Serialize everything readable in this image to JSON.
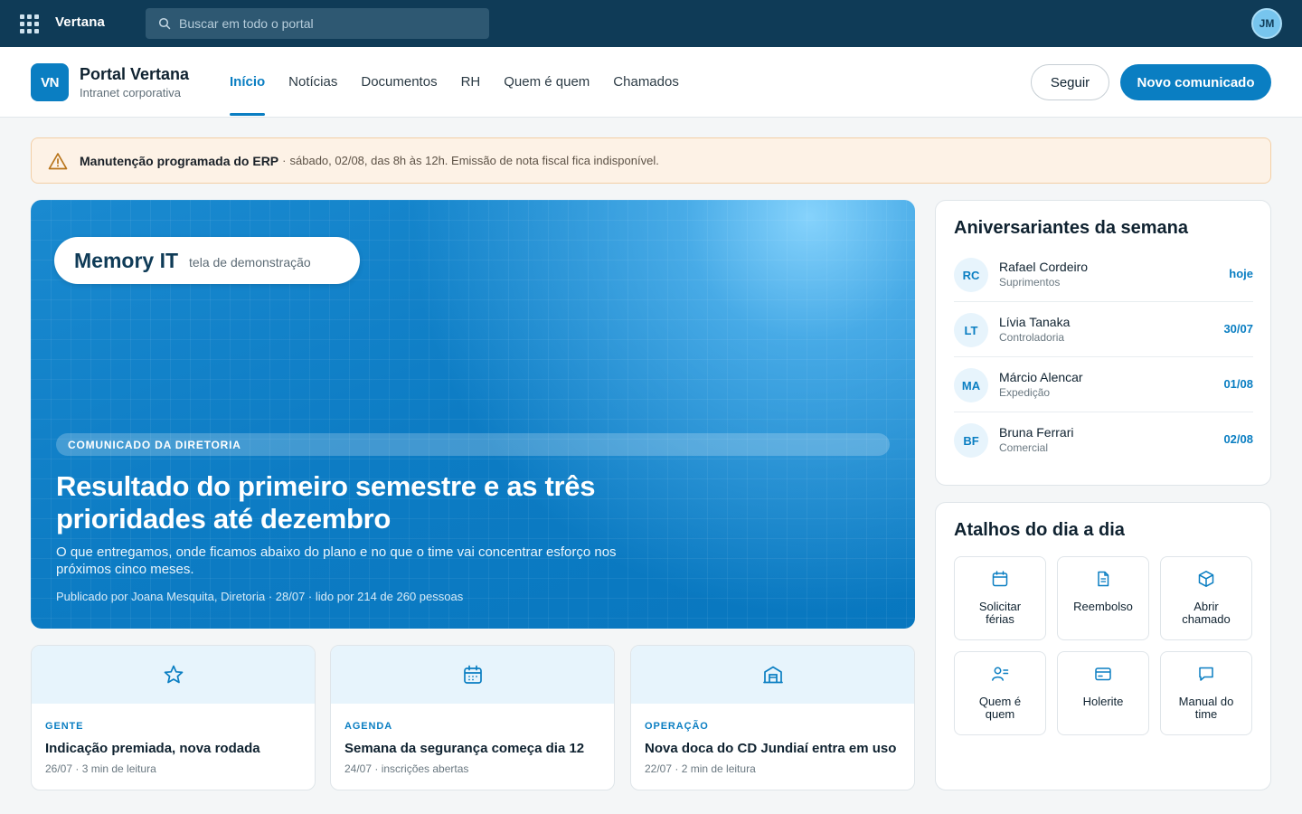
{
  "topbar": {
    "brand": "Vertana",
    "search_placeholder": "Buscar em todo o portal",
    "user_initials": "JM"
  },
  "header": {
    "logo_initials": "VN",
    "title": "Portal Vertana",
    "subtitle": "Intranet corporativa",
    "nav": [
      {
        "label": "Início",
        "active": true
      },
      {
        "label": "Notícias",
        "active": false
      },
      {
        "label": "Documentos",
        "active": false
      },
      {
        "label": "RH",
        "active": false
      },
      {
        "label": "Quem é quem",
        "active": false
      },
      {
        "label": "Chamados",
        "active": false
      }
    ],
    "follow_label": "Seguir",
    "new_label": "Novo comunicado"
  },
  "alert": {
    "icon": "warning-icon",
    "title": "Manutenção programada do ERP",
    "separator": "·",
    "text": "sábado, 02/08, das 8h às 12h. Emissão de nota fiscal fica indisponível."
  },
  "hero": {
    "badge_title": "Memory IT",
    "badge_sub": "tela de demonstração",
    "tag": "COMUNICADO DA DIRETORIA",
    "title": "Resultado do primeiro semestre e as três prioridades até dezembro",
    "description": "O que entregamos, onde ficamos abaixo do plano e no que o time vai concentrar esforço nos próximos cinco meses.",
    "meta": "Publicado por Joana Mesquita, Diretoria · 28/07 · lido por 214 de 260 pessoas"
  },
  "cards": [
    {
      "icon": "star-icon",
      "category": "GENTE",
      "title": "Indicação premiada, nova rodada",
      "meta": "26/07 · 3 min de leitura"
    },
    {
      "icon": "calendar-icon",
      "category": "AGENDA",
      "title": "Semana da segurança começa dia 12",
      "meta": "24/07 · inscrições abertas"
    },
    {
      "icon": "warehouse-icon",
      "category": "OPERAÇÃO",
      "title": "Nova doca do CD Jundiaí entra em uso",
      "meta": "22/07 · 2 min de leitura"
    }
  ],
  "birthdays": {
    "title": "Aniversariantes da semana",
    "items": [
      {
        "initials": "RC",
        "name": "Rafael Cordeiro",
        "dept": "Suprimentos",
        "date": "hoje"
      },
      {
        "initials": "LT",
        "name": "Lívia Tanaka",
        "dept": "Controladoria",
        "date": "30/07"
      },
      {
        "initials": "MA",
        "name": "Márcio Alencar",
        "dept": "Expedição",
        "date": "01/08"
      },
      {
        "initials": "BF",
        "name": "Bruna Ferrari",
        "dept": "Comercial",
        "date": "02/08"
      }
    ]
  },
  "shortcuts": {
    "title": "Atalhos do dia a dia",
    "items": [
      {
        "icon": "calendar-icon",
        "line1": "Solicitar",
        "line2": "férias"
      },
      {
        "icon": "document-icon",
        "line1": "Reembolso",
        "line2": ""
      },
      {
        "icon": "box-icon",
        "line1": "Abrir",
        "line2": "chamado"
      },
      {
        "icon": "people-icon",
        "line1": "Quem é",
        "line2": "quem"
      },
      {
        "icon": "card-icon",
        "line1": "Holerite",
        "line2": ""
      },
      {
        "icon": "chat-icon",
        "line1": "Manual do",
        "line2": "time"
      }
    ]
  },
  "colors": {
    "topbar": "#0f3b57",
    "accent": "#0a7ec2",
    "alert_bg": "#fdf2e6",
    "alert_icon": "#c07a16"
  }
}
